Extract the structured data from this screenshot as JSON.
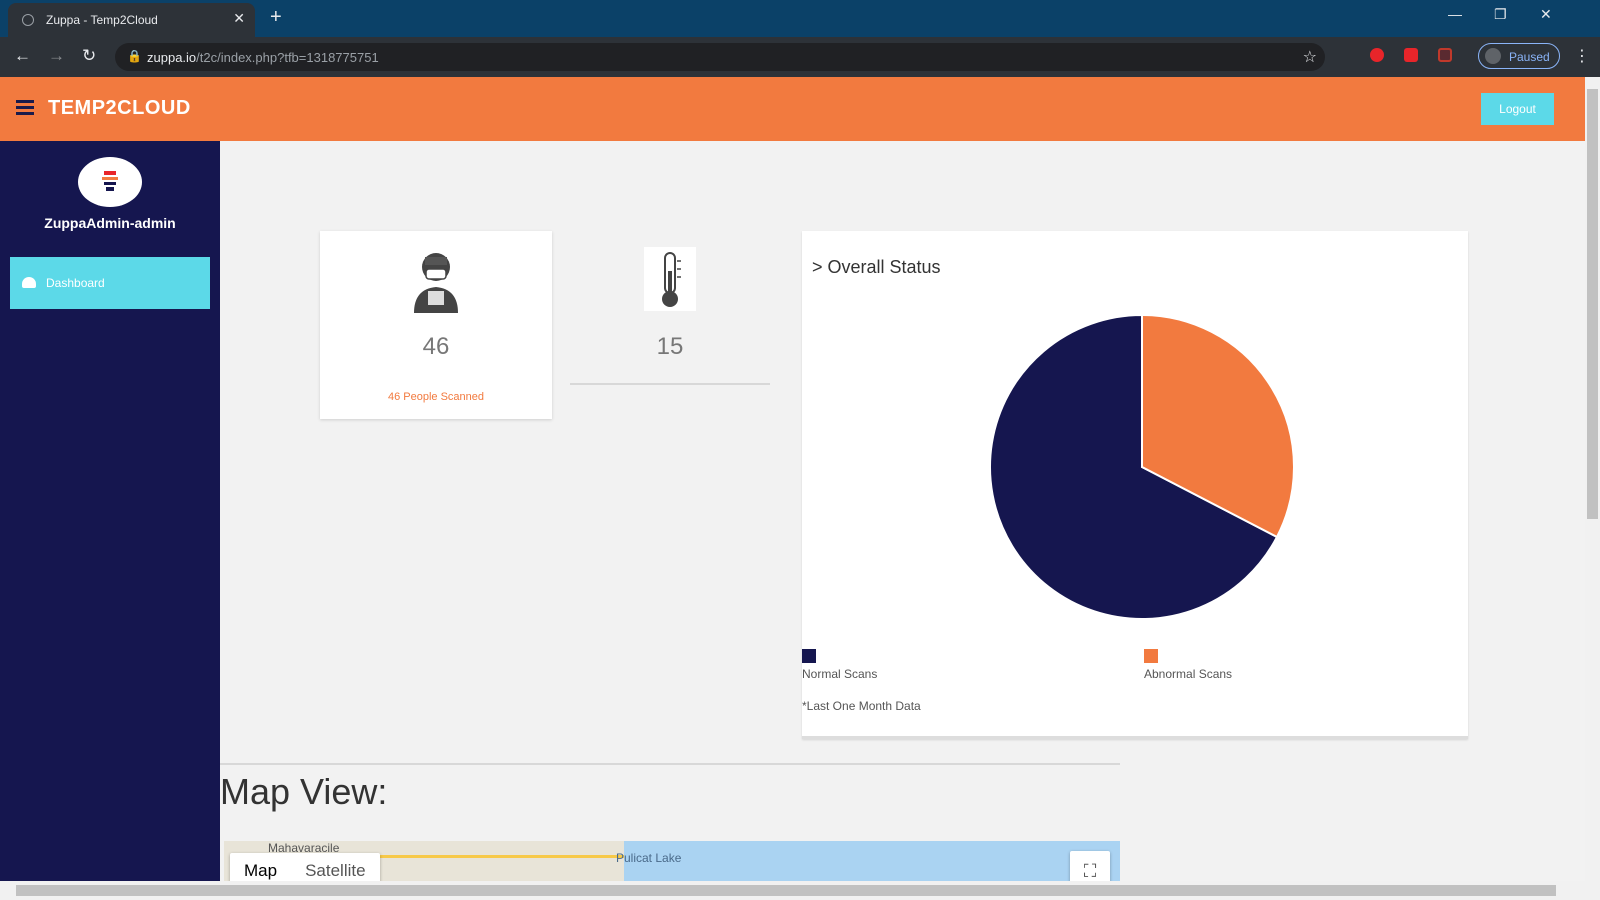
{
  "browser": {
    "tab_title": "Zuppa - Temp2Cloud",
    "tab_close": "✕",
    "new_tab": "+",
    "url_host": "zuppa.io",
    "url_path": "/t2c/index.php?tfb=1318775751",
    "profile_label": "Paused"
  },
  "header": {
    "brand": "TEMP2CLOUD",
    "logout_label": "Logout"
  },
  "sidebar": {
    "user_name": "ZuppaAdmin-admin",
    "items": [
      {
        "label": "Dashboard"
      }
    ]
  },
  "stats": {
    "people_count": "46",
    "people_label": "46 People Scanned",
    "temp_count": "15"
  },
  "chart_card": {
    "title": "> Overall Status",
    "legend_normal": "Normal Scans",
    "legend_abnormal": "Abnormal Scans",
    "note": "*Last One Month Data"
  },
  "chart_data": {
    "type": "pie",
    "title": "> Overall Status",
    "categories": [
      "Normal Scans",
      "Abnormal Scans"
    ],
    "values": [
      31,
      15
    ],
    "colors": [
      "#15164f",
      "#f27a3f"
    ],
    "legend": "bottom"
  },
  "map": {
    "heading": "Map View:",
    "map_tab": "Map",
    "satellite_tab": "Satellite",
    "place_1": "Mahavaracile",
    "place_2": "Pulicat Lake"
  },
  "colors": {
    "header": "#f27a3f",
    "sidebar": "#15164f",
    "accent": "#5cd9e8"
  }
}
